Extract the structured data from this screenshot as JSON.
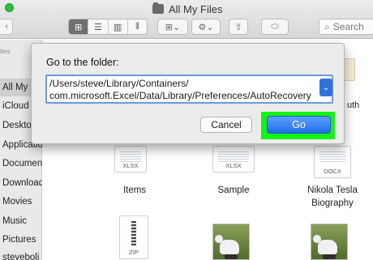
{
  "window": {
    "title": "All My Files"
  },
  "toolbar": {
    "back_glyph": "‹",
    "view_glyphs": [
      "⊞",
      "☰",
      "▥",
      "⫴"
    ],
    "arrange_glyph": "⊞⌄",
    "action_glyph": "⚙⌄",
    "share_glyph": "⇧",
    "tag_glyph": "⬭",
    "search_label": "Search",
    "search_glyph": "⌕"
  },
  "sidebar": {
    "heading": "ites",
    "items": [
      "All My",
      "iCloud",
      "Deskto",
      "Applications",
      "Documents",
      "Downloads",
      "Movies",
      "Music",
      "Pictures",
      "steveboli"
    ]
  },
  "files": {
    "row1": [
      {
        "ext": "XLSX",
        "label": "Items"
      },
      {
        "ext": "XLSX",
        "label": "Sample"
      },
      {
        "ext": "DOCX",
        "label": "Nikola Tesla Biography"
      }
    ],
    "row2": [
      {
        "ext": "ZIP"
      }
    ],
    "partial_label": "uth"
  },
  "dialog": {
    "title": "Go to the folder:",
    "path_line1": "/Users/steve/Library/Containers/",
    "path_line2": "com.microsoft.Excel/Data/Library/Preferences/AutoRecovery",
    "dropdown_glyph": "⌄",
    "cancel_label": "Cancel",
    "go_label": "Go",
    "highlight_color": "#16f216"
  }
}
